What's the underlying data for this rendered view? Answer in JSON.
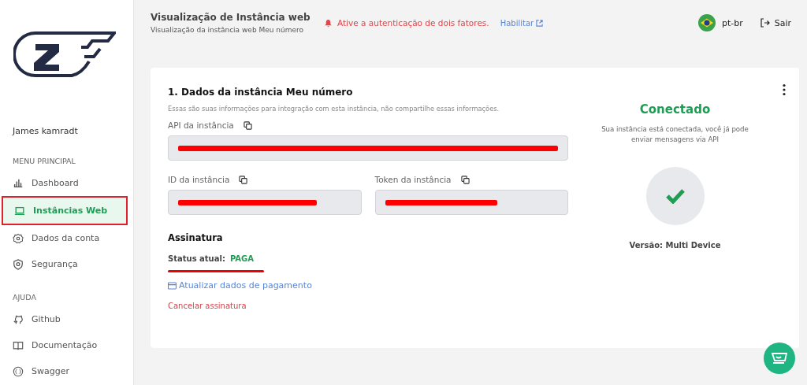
{
  "sidebar": {
    "user": "James kamradt",
    "sections": [
      {
        "title": "MENU PRINCIPAL",
        "items": [
          {
            "label": "Dashboard",
            "selected": false
          },
          {
            "label": "Instâncias Web",
            "selected": true
          },
          {
            "label": "Dados da conta",
            "selected": false
          },
          {
            "label": "Segurança",
            "selected": false
          }
        ]
      },
      {
        "title": "AJUDA",
        "items": [
          {
            "label": "Github",
            "selected": false
          },
          {
            "label": "Documentação",
            "selected": false
          },
          {
            "label": "Swagger",
            "selected": false
          }
        ]
      }
    ]
  },
  "header": {
    "title": "Visualização de Instância web",
    "subtitle": "Visualização da instância web Meu número",
    "alert": "Ative a autenticação de dois fatores.",
    "alert_link": "Habilitar",
    "language": "pt-br",
    "logout": "Sair"
  },
  "card": {
    "title": "1. Dados da instância Meu número",
    "description": "Essas são suas informações para integração com esta instância, não compartilhe essas informações.",
    "fields": [
      {
        "label": "API da instância",
        "redacted": true
      },
      {
        "label": "ID da instância",
        "redacted": true
      },
      {
        "label": "Token da instância",
        "redacted": true
      }
    ],
    "subscription": {
      "title": "Assinatura",
      "status_label": "Status atual:",
      "status": "PAGA",
      "renew_redacted": true,
      "update_link": "Atualizar dados de pagamento",
      "cancel_link": "Cancelar assinatura"
    },
    "status": {
      "title": "Conectado",
      "message": "Sua instância está conectada, você já pode enviar mensagens via API",
      "connected": true,
      "version": "Versão: Multi Device"
    }
  }
}
